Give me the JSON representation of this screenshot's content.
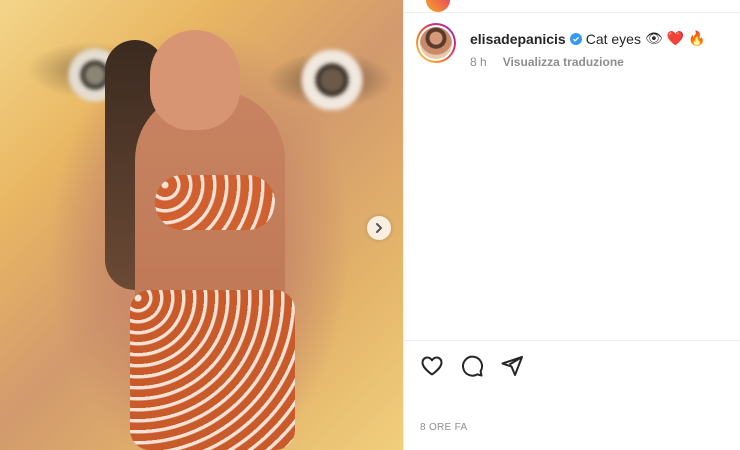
{
  "post": {
    "media_alt": "",
    "next_icon": "chevron-right-icon"
  },
  "author": {
    "username": "elisadepanicis",
    "verified": true
  },
  "caption": {
    "text": "Cat eyes",
    "emojis": [
      "👁",
      "❤️",
      "🔥"
    ]
  },
  "meta": {
    "time_ago": "8 h",
    "translate_label": "Visualizza traduzione"
  },
  "actions": {
    "like_icon": "heart-icon",
    "comment_icon": "comment-icon",
    "share_icon": "send-icon"
  },
  "footer": {
    "date_label": "8 ORE FA"
  },
  "colors": {
    "verified": "#3897f0",
    "text": "#262626",
    "muted": "#8e8e8e"
  }
}
